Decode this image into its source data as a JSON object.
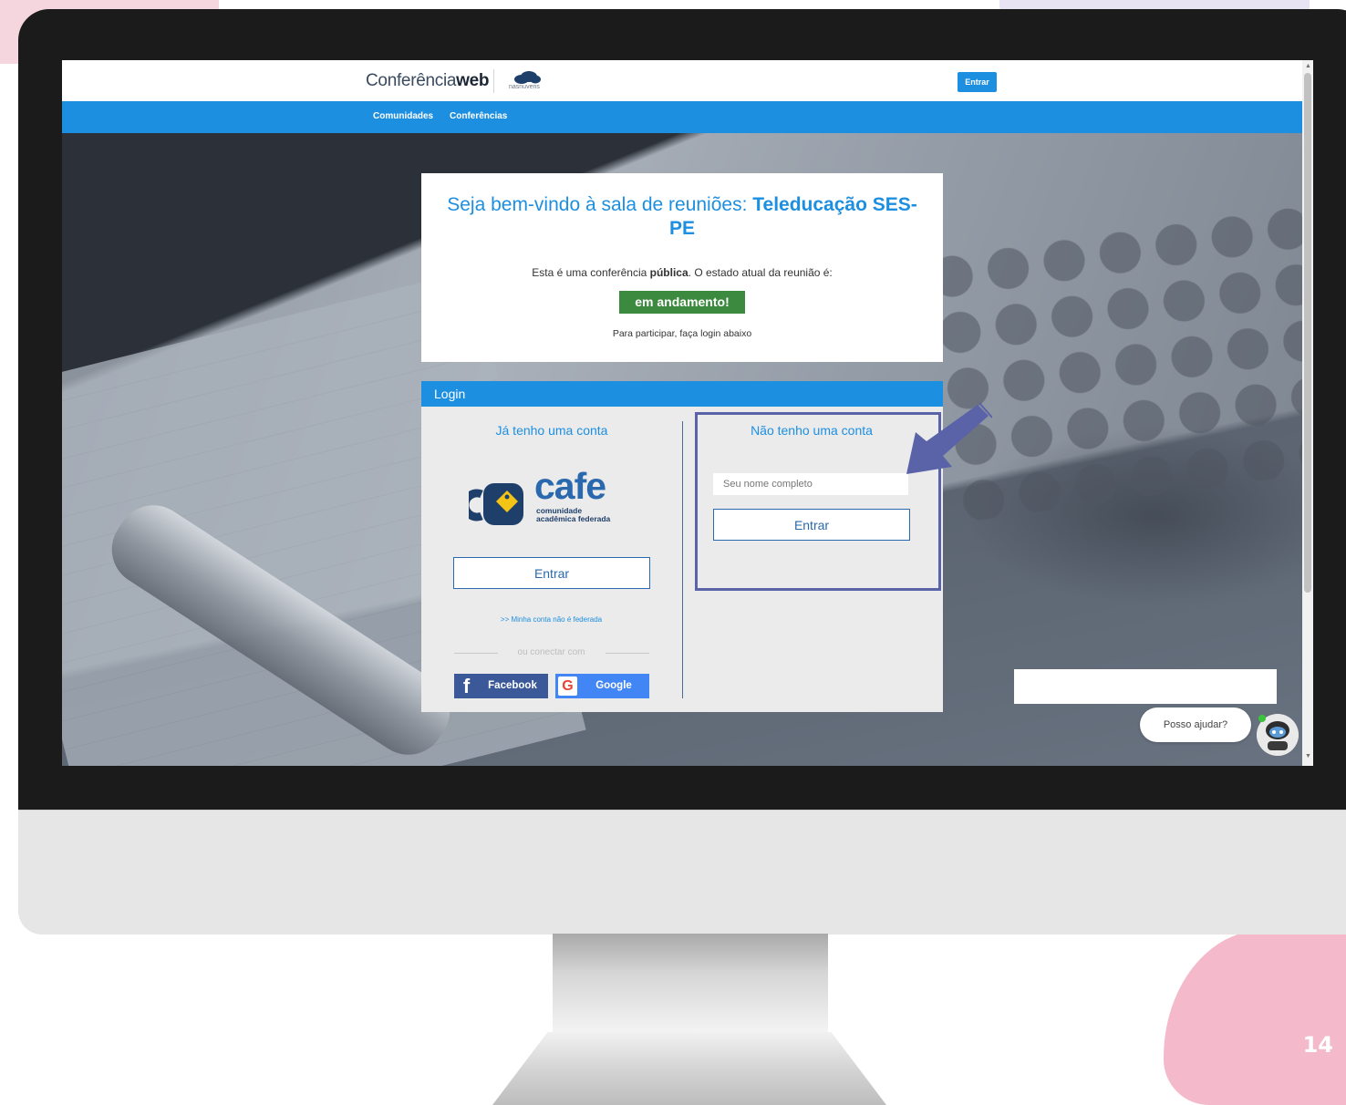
{
  "slide": {
    "number": "14"
  },
  "site": {
    "logo_light": "Conferência",
    "logo_bold": "web",
    "partner_logo_text": "nasnuvens",
    "top_login_button": "Entrar"
  },
  "nav": {
    "items": [
      "Comunidades",
      "Conferências"
    ]
  },
  "welcome": {
    "title_prefix": "Seja bem-vindo à sala de reuniões: ",
    "title_room": "Teleducação SES-PE",
    "desc_prefix": "Esta é uma conferência ",
    "desc_bold": "pública",
    "desc_suffix": ". O estado atual da reunião é:",
    "status": "em andamento!",
    "hint": "Para participar, faça login abaixo"
  },
  "login": {
    "header": "Login",
    "has_account": {
      "title": "Já tenho uma conta",
      "cafe_word": "cafe",
      "cafe_sub1": "comunidade",
      "cafe_sub2": "acadêmica federada",
      "button": "Entrar",
      "link": ">> Minha conta não é federada",
      "or_text": "ou conectar com",
      "facebook": "Facebook",
      "google": "Google"
    },
    "no_account": {
      "title": "Não tenho uma conta",
      "name_placeholder": "Seu nome completo",
      "name_value": "",
      "button": "Entrar"
    }
  },
  "chat": {
    "bubble": "Posso ajudar?"
  },
  "colors": {
    "brand_blue": "#1d8fe0",
    "status_green": "#3c8a3f",
    "facebook": "#3b5998",
    "google": "#4285f4",
    "highlight": "#5a63a8"
  }
}
